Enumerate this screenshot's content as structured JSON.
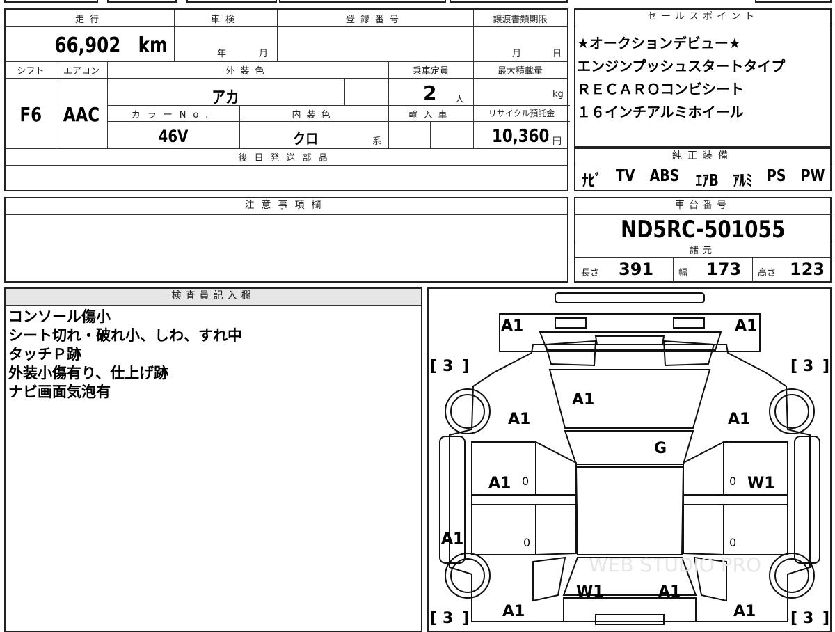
{
  "mileage": {
    "label": "走行",
    "value": "66,902",
    "unit": "km"
  },
  "inspection": {
    "label": "車検",
    "year_unit": "年",
    "month_unit": "月"
  },
  "registration": {
    "label": "登録番号",
    "value": ""
  },
  "transfer": {
    "label": "譲渡書類期限",
    "month_unit": "月",
    "day_unit": "日"
  },
  "shift": {
    "label": "シフト",
    "value": "F6"
  },
  "aircon": {
    "label": "エアコン",
    "value": "AAC"
  },
  "exterior_color": {
    "label": "外装色",
    "value": "アカ"
  },
  "capacity": {
    "label": "乗車定員",
    "value": "2",
    "unit": "人"
  },
  "max_load": {
    "label": "最大積載量",
    "unit": "kg"
  },
  "color_no": {
    "label": "カラーNo.",
    "value": "46V"
  },
  "interior_color": {
    "label": "内装色",
    "value": "クロ",
    "suffix": "系"
  },
  "import": {
    "label": "輸入車"
  },
  "recycle": {
    "label": "リサイクル預託金",
    "value": "10,360",
    "unit": "円"
  },
  "later_parts": {
    "label": "後日発送部品"
  },
  "sales_points": {
    "label": "セールスポイント",
    "lines": [
      "★オークションデビュー★",
      "エンジンプッシュスタートタイプ",
      "ＲＥＣＡＲＯコンビシート",
      "１６インチアルミホイール"
    ]
  },
  "genuine": {
    "label": "純正装備",
    "items": [
      "ﾅﾋﾞ",
      "TV",
      "ABS",
      "ｴｱB",
      "ｱﾙﾐ",
      "PS",
      "PW"
    ]
  },
  "notes": {
    "label": "注意事項欄"
  },
  "chassis": {
    "label": "車台番号",
    "value": "ND5RC-501055"
  },
  "specs": {
    "label": "諸元",
    "length_label": "長さ",
    "length": "391",
    "width_label": "幅",
    "width": "173",
    "height_label": "高さ",
    "height": "123"
  },
  "inspector": {
    "label": "検査員記入欄",
    "lines": [
      "コンソール傷小",
      "シート切れ・破れ小、しわ、すれ中",
      "タッチＰ跡",
      "外装小傷有り、仕上げ跡",
      "ナビ画面気泡有"
    ]
  },
  "diagram": {
    "marks": {
      "front_left": "A1",
      "front_right": "A1",
      "tire_fl": "3",
      "tire_fr": "3",
      "tire_rl": "3",
      "tire_rr": "3",
      "hood": "A1",
      "fender_l": "A1",
      "fender_r": "A1",
      "windshield": "G",
      "door_fl": "A1",
      "door_fr": "W1",
      "sill_l": "A1",
      "trunk_l": "W1",
      "trunk_r": "A1",
      "rear_l": "A1",
      "rear_r": "A1",
      "zero": "0"
    },
    "watermark": "WEB STUDIO PRO"
  }
}
